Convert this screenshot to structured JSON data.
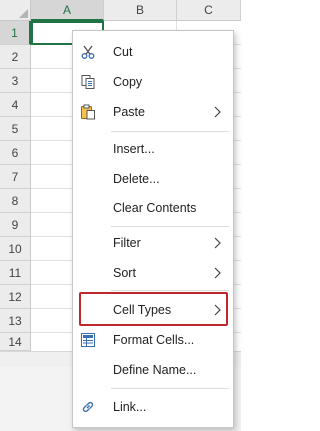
{
  "sheet": {
    "columns": [
      "A",
      "B",
      "C"
    ],
    "rows": [
      "1",
      "2",
      "3",
      "4",
      "5",
      "6",
      "7",
      "8",
      "9",
      "10",
      "11",
      "12",
      "13",
      "14"
    ]
  },
  "menu": {
    "items": [
      {
        "label": "Cut",
        "icon": "scissors-icon",
        "submenu": false
      },
      {
        "label": "Copy",
        "icon": "copy-icon",
        "submenu": false
      },
      {
        "label": "Paste",
        "icon": "paste-icon",
        "submenu": true
      },
      {
        "label": "Insert...",
        "icon": "",
        "submenu": false
      },
      {
        "label": "Delete...",
        "icon": "",
        "submenu": false
      },
      {
        "label": "Clear Contents",
        "icon": "",
        "submenu": false
      },
      {
        "label": "Filter",
        "icon": "",
        "submenu": true
      },
      {
        "label": "Sort",
        "icon": "",
        "submenu": true
      },
      {
        "label": "Cell Types",
        "icon": "",
        "submenu": true,
        "highlighted": true
      },
      {
        "label": "Format Cells...",
        "icon": "format-cells-icon",
        "submenu": false
      },
      {
        "label": "Define Name...",
        "icon": "",
        "submenu": false
      },
      {
        "label": "Link...",
        "icon": "link-icon",
        "submenu": false
      }
    ]
  },
  "colors": {
    "accent": "#217346",
    "highlight_border": "#c0272d"
  }
}
